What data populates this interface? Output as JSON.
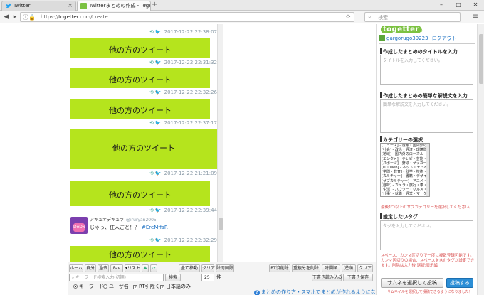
{
  "browser": {
    "tabs": [
      {
        "label": "Twitter",
        "active": false
      },
      {
        "label": "Twitterまとめの作成 - Toge",
        "active": true
      }
    ],
    "url_prefix": "https://",
    "url_host": "togetter.com",
    "url_path": "/create",
    "search_placeholder": "検索"
  },
  "timeline": {
    "items": [
      {
        "timestamp": "2017-12-22 22:38:07"
      },
      {
        "text": "他の方のツイート",
        "timestamp": "2017-12-22 22:31:32"
      },
      {
        "text": "他の方のツイート",
        "timestamp": "2017-12-22 22:32:26"
      },
      {
        "text": "他の方のツイート",
        "timestamp": "2017-12-22 22:37:17"
      },
      {
        "text": "他の方のツイート",
        "timestamp": "2017-12-22 21:21:09"
      },
      {
        "text": "他の方のツイート",
        "timestamp": "2017-12-22 22:39:44"
      },
      {
        "text": "他の方のツイート",
        "timestamp": "2017-12-22 22:32:29"
      }
    ],
    "real_tweet": {
      "name": "アキュオデキュラ",
      "handle": "@iruryan2005",
      "text": "じゃっ、住人ごと！？",
      "link": "#EreMffsR",
      "avatar_label": "DoDx"
    }
  },
  "toolbar": {
    "tabs": [
      "ホーム",
      "自分",
      "過去",
      "Fav",
      "▾リスト"
    ],
    "all_move": "全て移動",
    "clear": "クリア",
    "clear_dup": "除刃固除",
    "rt_delete": "RT済削除",
    "dup_delete": "重複分を削除",
    "by_time": "時間順",
    "reverse": "逆順",
    "clear2": "クリア",
    "read_draft": "下書き読み込み",
    "save_draft": "下書き保存",
    "search_placeholder": "キーワード検索入力(初期)",
    "search_btn": "検索",
    "count": "25",
    "count_unit": "件",
    "radio_keyword": "キーワード",
    "radio_user": "ユーザ名",
    "chk_rt": "RT引除く",
    "chk_ja": "日本語のみ",
    "help_link": "まとめの作り方・スマホでまとめが作れるようになりました！"
  },
  "panel": {
    "logo": "togetter",
    "logo_sub": "ω",
    "username": "gargorugo39223",
    "logout": "ログアウト",
    "title_heading": "作成したまとめのタイトルを入力",
    "title_placeholder": "タイトルを入力してください。",
    "desc_heading": "作成したまとめの簡単な解説文を入力",
    "desc_placeholder": "簡単な解説文を入力してください。",
    "category_heading": "カテゴリーの選択",
    "categories": [
      "[ニュース] - 速報・国内外の",
      "[社会] - 政治・経済・環境問",
      "[地域] - 国内外のローカル",
      "[エンタメ] - テレビ・芸能・",
      "[スポーツ] - 野球・サッカー",
      "[IT・Web] - ネット・モバイル",
      "[学問・教育] - 科学・技術・",
      "[カルチャー] - 書籍・デザイ",
      "[サブカルチャー] - アニメ・",
      "[趣味] - カメラ・旅行・車・ア",
      "[生活] - ハウツー・グルメ・",
      "[仕事] - 就職・経営・マーケ"
    ],
    "category_note": "最後1つ以上のサブカテゴリーを選択してください。",
    "tag_heading": "設定したいタグ",
    "tag_placeholder": "タグを入力してください。",
    "warning": "スペース、カンマ区切りで一度に複数登録可能です。カンマ区切りの場合、スペースを含むタグが設定できます。削除は入力後 選択:表示編",
    "thumb_btn": "サムネを選択して投稿",
    "post_btn": "投稿する",
    "post_note": "サムネイルを選択して投稿できるようになりました！"
  },
  "colors": {
    "tweet_bg": "#b5e41d",
    "accent": "#2b8ed6",
    "warning": "#d94f4f"
  }
}
